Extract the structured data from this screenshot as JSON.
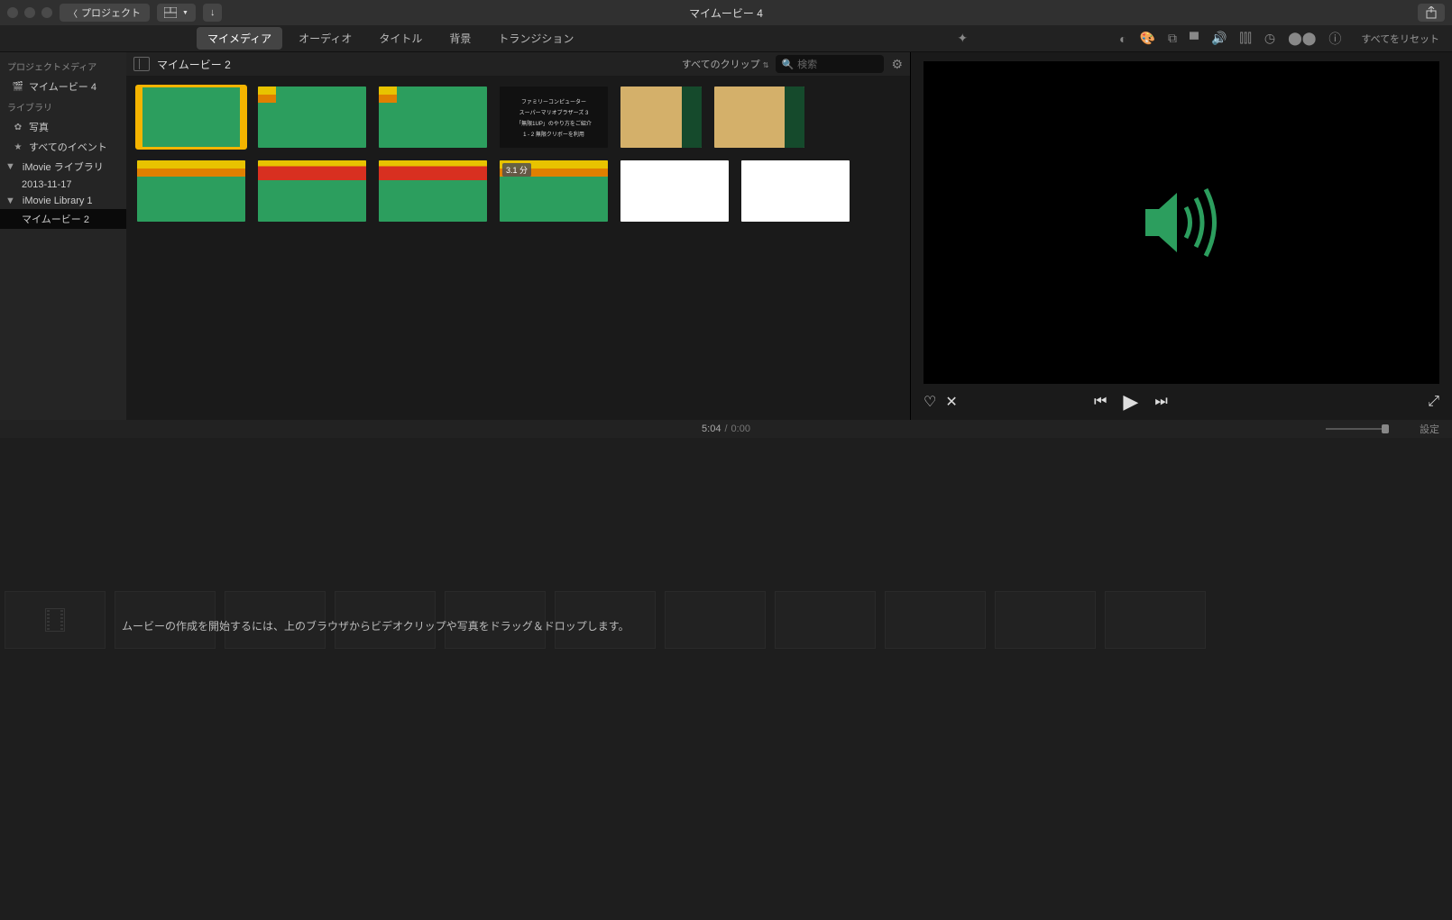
{
  "title": "マイムービー 4",
  "back_label": "プロジェクト",
  "tabs": [
    "マイメディア",
    "オーディオ",
    "タイトル",
    "背景",
    "トランジション"
  ],
  "reset_label": "すべてをリセット",
  "sidebar": {
    "sec_project": "プロジェクトメディア",
    "item_movie4": "マイムービー 4",
    "sec_library": "ライブラリ",
    "item_photos": "写真",
    "item_all_events": "すべてのイベント",
    "item_imovie_lib": "iMovie ライブラリ",
    "item_date": "2013-11-17",
    "item_imovie_lib1": "iMovie Library 1",
    "item_movie2": "マイムービー 2"
  },
  "browser": {
    "title": "マイムービー 2",
    "filter": "すべてのクリップ",
    "search_ph": "検索",
    "clip_badge": "3.1 分",
    "dark_lines": [
      "ファミリーコンピューター",
      "スーパーマリオブラザーズ 3",
      "「無限1UP」のやり方をご紹介",
      "1 - 2 無限クリボーを利用"
    ]
  },
  "time": {
    "cur": "5:04",
    "dur": "0:00",
    "settings": "設定"
  },
  "hint": "ムービーの作成を開始するには、上のブラウザからビデオクリップや写真をドラッグ＆ドロップします。"
}
